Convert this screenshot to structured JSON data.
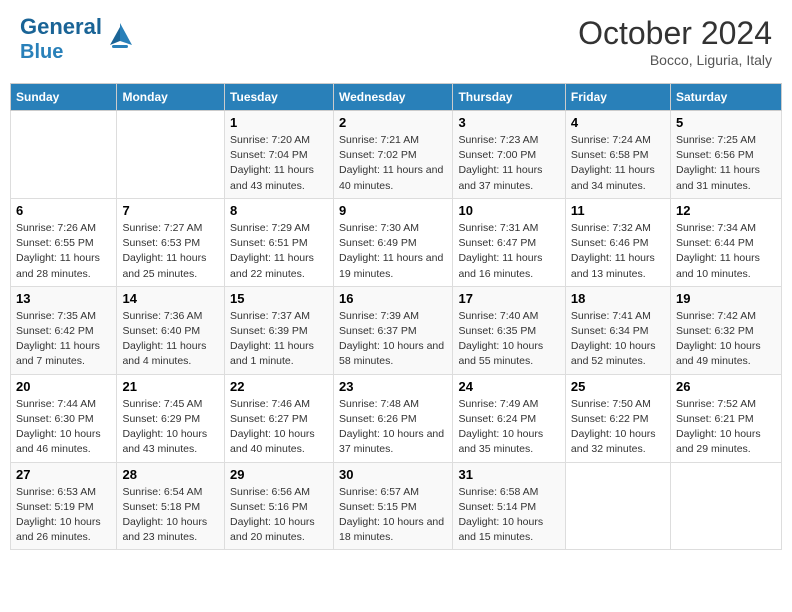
{
  "header": {
    "logo_text_general": "General",
    "logo_text_blue": "Blue",
    "month": "October 2024",
    "location": "Bocco, Liguria, Italy"
  },
  "days_of_week": [
    "Sunday",
    "Monday",
    "Tuesday",
    "Wednesday",
    "Thursday",
    "Friday",
    "Saturday"
  ],
  "weeks": [
    [
      {
        "day": "",
        "info": ""
      },
      {
        "day": "",
        "info": ""
      },
      {
        "day": "1",
        "info": "Sunrise: 7:20 AM\nSunset: 7:04 PM\nDaylight: 11 hours and 43 minutes."
      },
      {
        "day": "2",
        "info": "Sunrise: 7:21 AM\nSunset: 7:02 PM\nDaylight: 11 hours and 40 minutes."
      },
      {
        "day": "3",
        "info": "Sunrise: 7:23 AM\nSunset: 7:00 PM\nDaylight: 11 hours and 37 minutes."
      },
      {
        "day": "4",
        "info": "Sunrise: 7:24 AM\nSunset: 6:58 PM\nDaylight: 11 hours and 34 minutes."
      },
      {
        "day": "5",
        "info": "Sunrise: 7:25 AM\nSunset: 6:56 PM\nDaylight: 11 hours and 31 minutes."
      }
    ],
    [
      {
        "day": "6",
        "info": "Sunrise: 7:26 AM\nSunset: 6:55 PM\nDaylight: 11 hours and 28 minutes."
      },
      {
        "day": "7",
        "info": "Sunrise: 7:27 AM\nSunset: 6:53 PM\nDaylight: 11 hours and 25 minutes."
      },
      {
        "day": "8",
        "info": "Sunrise: 7:29 AM\nSunset: 6:51 PM\nDaylight: 11 hours and 22 minutes."
      },
      {
        "day": "9",
        "info": "Sunrise: 7:30 AM\nSunset: 6:49 PM\nDaylight: 11 hours and 19 minutes."
      },
      {
        "day": "10",
        "info": "Sunrise: 7:31 AM\nSunset: 6:47 PM\nDaylight: 11 hours and 16 minutes."
      },
      {
        "day": "11",
        "info": "Sunrise: 7:32 AM\nSunset: 6:46 PM\nDaylight: 11 hours and 13 minutes."
      },
      {
        "day": "12",
        "info": "Sunrise: 7:34 AM\nSunset: 6:44 PM\nDaylight: 11 hours and 10 minutes."
      }
    ],
    [
      {
        "day": "13",
        "info": "Sunrise: 7:35 AM\nSunset: 6:42 PM\nDaylight: 11 hours and 7 minutes."
      },
      {
        "day": "14",
        "info": "Sunrise: 7:36 AM\nSunset: 6:40 PM\nDaylight: 11 hours and 4 minutes."
      },
      {
        "day": "15",
        "info": "Sunrise: 7:37 AM\nSunset: 6:39 PM\nDaylight: 11 hours and 1 minute."
      },
      {
        "day": "16",
        "info": "Sunrise: 7:39 AM\nSunset: 6:37 PM\nDaylight: 10 hours and 58 minutes."
      },
      {
        "day": "17",
        "info": "Sunrise: 7:40 AM\nSunset: 6:35 PM\nDaylight: 10 hours and 55 minutes."
      },
      {
        "day": "18",
        "info": "Sunrise: 7:41 AM\nSunset: 6:34 PM\nDaylight: 10 hours and 52 minutes."
      },
      {
        "day": "19",
        "info": "Sunrise: 7:42 AM\nSunset: 6:32 PM\nDaylight: 10 hours and 49 minutes."
      }
    ],
    [
      {
        "day": "20",
        "info": "Sunrise: 7:44 AM\nSunset: 6:30 PM\nDaylight: 10 hours and 46 minutes."
      },
      {
        "day": "21",
        "info": "Sunrise: 7:45 AM\nSunset: 6:29 PM\nDaylight: 10 hours and 43 minutes."
      },
      {
        "day": "22",
        "info": "Sunrise: 7:46 AM\nSunset: 6:27 PM\nDaylight: 10 hours and 40 minutes."
      },
      {
        "day": "23",
        "info": "Sunrise: 7:48 AM\nSunset: 6:26 PM\nDaylight: 10 hours and 37 minutes."
      },
      {
        "day": "24",
        "info": "Sunrise: 7:49 AM\nSunset: 6:24 PM\nDaylight: 10 hours and 35 minutes."
      },
      {
        "day": "25",
        "info": "Sunrise: 7:50 AM\nSunset: 6:22 PM\nDaylight: 10 hours and 32 minutes."
      },
      {
        "day": "26",
        "info": "Sunrise: 7:52 AM\nSunset: 6:21 PM\nDaylight: 10 hours and 29 minutes."
      }
    ],
    [
      {
        "day": "27",
        "info": "Sunrise: 6:53 AM\nSunset: 5:19 PM\nDaylight: 10 hours and 26 minutes."
      },
      {
        "day": "28",
        "info": "Sunrise: 6:54 AM\nSunset: 5:18 PM\nDaylight: 10 hours and 23 minutes."
      },
      {
        "day": "29",
        "info": "Sunrise: 6:56 AM\nSunset: 5:16 PM\nDaylight: 10 hours and 20 minutes."
      },
      {
        "day": "30",
        "info": "Sunrise: 6:57 AM\nSunset: 5:15 PM\nDaylight: 10 hours and 18 minutes."
      },
      {
        "day": "31",
        "info": "Sunrise: 6:58 AM\nSunset: 5:14 PM\nDaylight: 10 hours and 15 minutes."
      },
      {
        "day": "",
        "info": ""
      },
      {
        "day": "",
        "info": ""
      }
    ]
  ]
}
